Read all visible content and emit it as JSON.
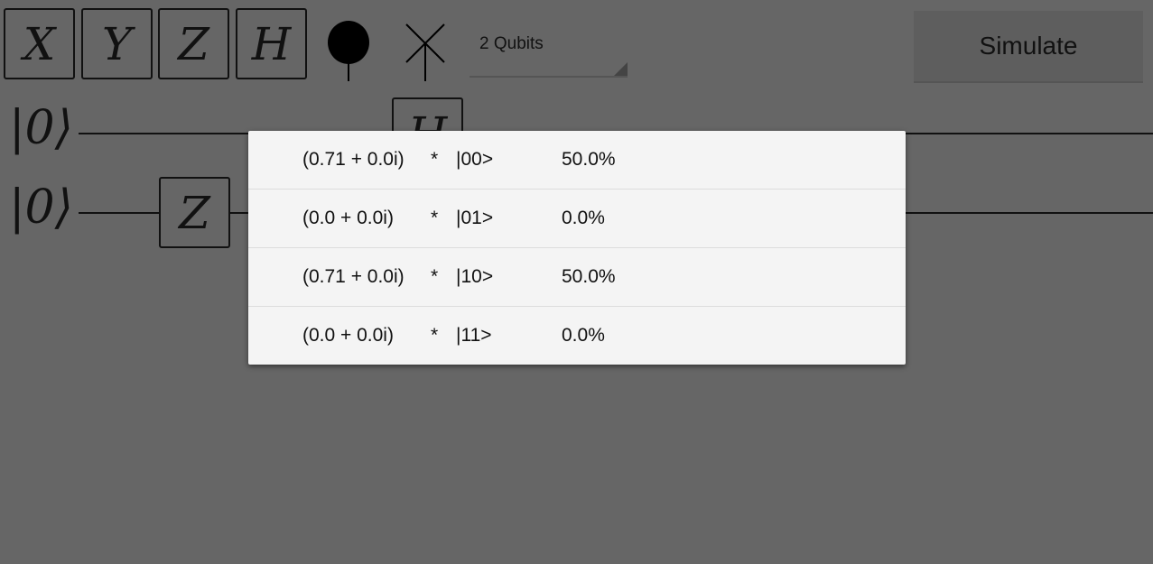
{
  "toolbar": {
    "gates": [
      "X",
      "Y",
      "Z",
      "H"
    ],
    "qubit_select": "2 Qubits",
    "simulate_label": "Simulate"
  },
  "circuit": {
    "kets": [
      "|0⟩",
      "|0⟩"
    ],
    "gates": [
      {
        "label": "H",
        "qubit": 0
      },
      {
        "label": "Z",
        "qubit": 1
      }
    ]
  },
  "results": [
    {
      "amplitude": "(0.71 + 0.0i)",
      "op": "*",
      "state": "|00>",
      "probability": "50.0%"
    },
    {
      "amplitude": "(0.0 + 0.0i)",
      "op": "*",
      "state": "|01>",
      "probability": "0.0%"
    },
    {
      "amplitude": "(0.71 + 0.0i)",
      "op": "*",
      "state": "|10>",
      "probability": "50.0%"
    },
    {
      "amplitude": "(0.0 + 0.0i)",
      "op": "*",
      "state": "|11>",
      "probability": "0.0%"
    }
  ]
}
